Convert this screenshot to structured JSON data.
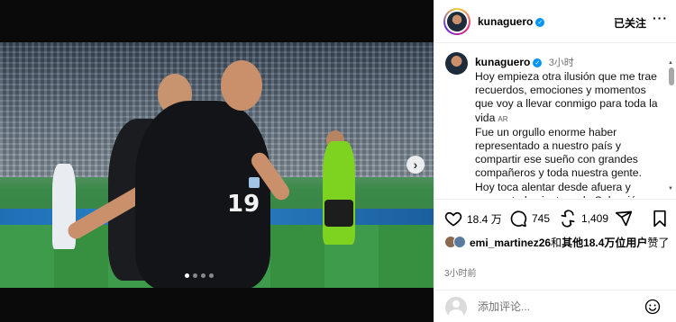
{
  "header": {
    "username": "kunaguero",
    "verified_icon": "verified-badge-icon",
    "follow_status": "已关注",
    "more_icon": "···"
  },
  "caption": {
    "username": "kunaguero",
    "time": "3小时",
    "paragraph_1": "Hoy empieza otra ilusión que me trae recuerdos, emociones y momentos que voy a llevar conmigo para toda la vida",
    "translate_tag": "AR",
    "paragraph_2": "Fue un orgullo enorme haber representado a nuestro país y compartir ese sueño con grandes compañeros y toda nuestra gente. Hoy toca alentar desde afuera y apoyar todos juntos a la Selección."
  },
  "media": {
    "jersey_number": "19",
    "carousel_dots": 4,
    "active_dot": 0
  },
  "actions": {
    "likes": "18.4 万",
    "comments": "745",
    "reposts": "1,409",
    "like_icon": "heart-icon",
    "comment_icon": "comment-icon",
    "repost_icon": "repost-icon",
    "share_icon": "share-icon",
    "save_icon": "bookmark-icon"
  },
  "liked_by": {
    "user": "emi_martinez26",
    "connector": "和",
    "others": "其他18.4万位用户",
    "suffix": "赞了"
  },
  "post_time": "3小时前",
  "comment_box": {
    "placeholder": "添加评论..."
  },
  "colors": {
    "verified": "#0095f6",
    "secondary_text": "#737373"
  }
}
